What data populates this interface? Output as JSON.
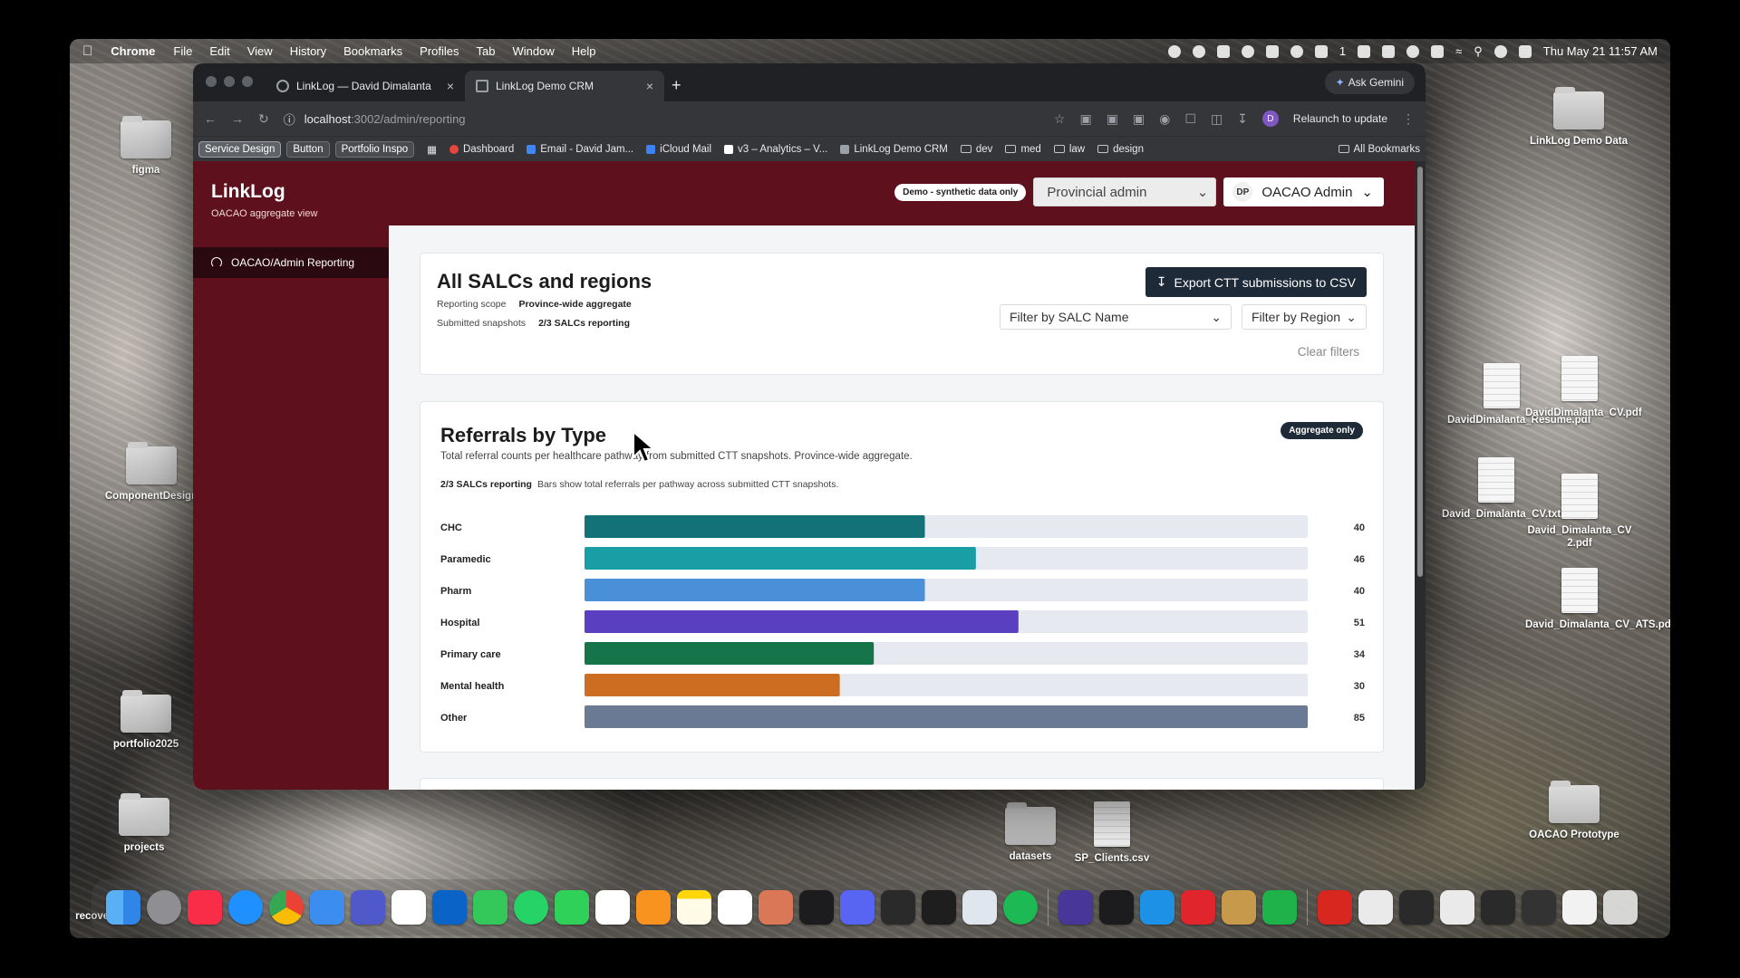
{
  "menubar": {
    "app": "Chrome",
    "menus": [
      "File",
      "Edit",
      "View",
      "History",
      "Bookmarks",
      "Profiles",
      "Tab",
      "Window",
      "Help"
    ],
    "clock": "Thu May 21  11:57 AM",
    "notif_count": "1"
  },
  "desktop_icons": {
    "figma": "figma",
    "component_design": "ComponentDesign",
    "portfolio2025": "portfolio2025",
    "projects": "projects",
    "linklog_demo": "LinkLog Demo Data",
    "resume": "DavidDimalanta_Resume.pdf",
    "cv": "DavidDimalanta_CV.pdf",
    "cv_txt": "David_Dimalanta_CV.txt",
    "cv2": "David_Dimalanta_CV 2.pdf",
    "cv_ats": "David_Dimalanta_CV_ATS.pdf",
    "oacao": "OACAO Prototype",
    "datasets": "datasets",
    "sp_clients": "SP_Clients.csv",
    "recovery": "recovery_co"
  },
  "browser": {
    "tabs": [
      {
        "label": "LinkLog — David Dimalanta"
      },
      {
        "label": "LinkLog Demo CRM"
      }
    ],
    "new_tab": "+",
    "ask_gemini": "Ask Gemini",
    "url_host": "localhost",
    "url_path": ":3002/admin/reporting",
    "relaunch": "Relaunch to update",
    "profile_initial": "D",
    "bookmarks": {
      "chips": [
        "Service Design",
        "Button",
        "Portfolio Inspo"
      ],
      "items": [
        "Dashboard",
        "Email - David Jam...",
        "iCloud Mail",
        "v3 – Analytics – V...",
        "LinkLog Demo CRM"
      ],
      "folders": [
        "dev",
        "med",
        "law",
        "design"
      ],
      "all": "All Bookmarks"
    }
  },
  "app": {
    "brand": "LinkLog",
    "brand_sub": "OACAO aggregate view",
    "demo_badge": "Demo - synthetic data only",
    "role_select": "Provincial admin",
    "user_initials": "DP",
    "user_name": "OACAO Admin",
    "sidebar_items": [
      {
        "label": "OACAO/Admin Reporting"
      }
    ]
  },
  "scope": {
    "title": "All SALCs and regions",
    "reporting_scope_label": "Reporting scope",
    "reporting_scope_value": "Province-wide aggregate",
    "snapshots_label": "Submitted snapshots",
    "snapshots_value": "2/3 SALCs reporting",
    "export_label": "Export CTT submissions to CSV",
    "filter_salc": "Filter by SALC Name",
    "filter_region": "Filter by Region",
    "clear_filters": "Clear filters"
  },
  "referrals": {
    "title": "Referrals by Type",
    "badge": "Aggregate only",
    "description": "Total referral counts per healthcare pathway from submitted CTT snapshots. Province-wide aggregate.",
    "meta_bold": "2/3 SALCs reporting",
    "meta_text": "Bars show total referrals per pathway across submitted CTT snapshots."
  },
  "chart_data": {
    "type": "bar",
    "orientation": "horizontal",
    "categories": [
      "CHC",
      "Paramedic",
      "Pharm",
      "Hospital",
      "Primary care",
      "Mental health",
      "Other"
    ],
    "values": [
      40,
      46,
      40,
      51,
      34,
      30,
      85
    ],
    "colors": [
      "#137178",
      "#1a9ea5",
      "#4a90d9",
      "#5a3fc0",
      "#16744a",
      "#cc6d22",
      "#6a7a94"
    ],
    "track_color": "#e6eaf0",
    "xlim": [
      0,
      85
    ]
  }
}
